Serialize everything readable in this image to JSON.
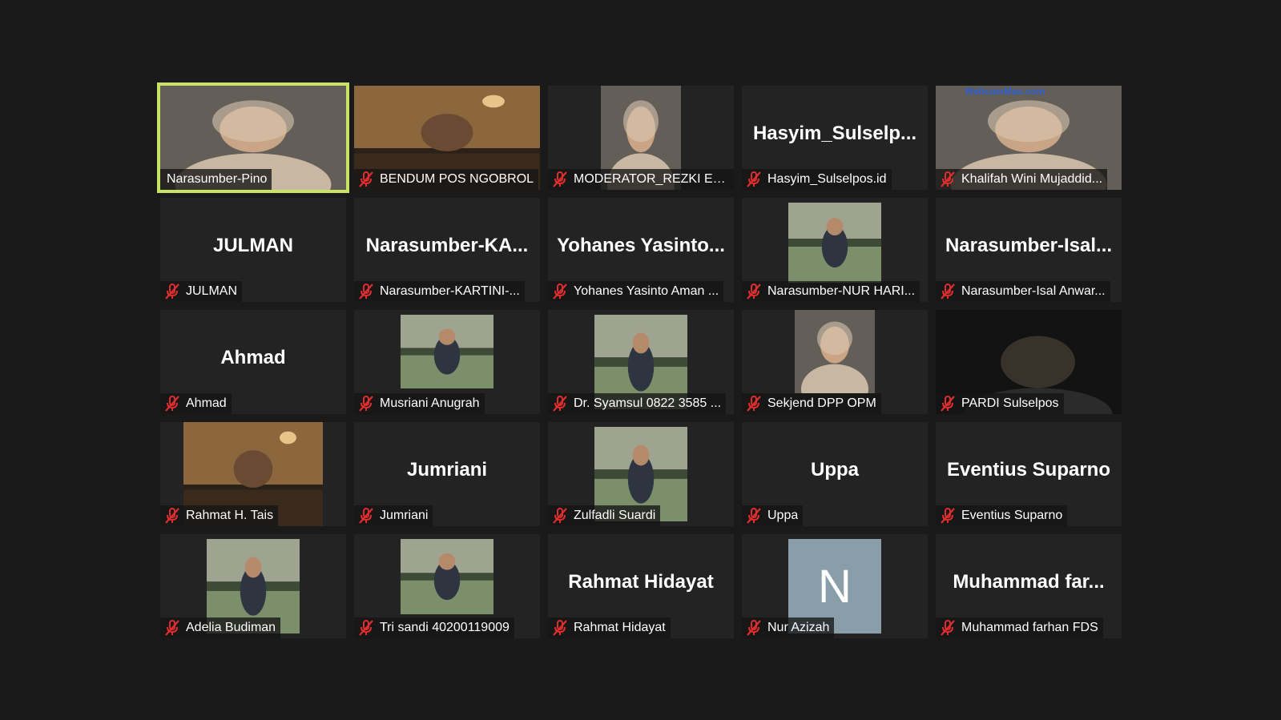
{
  "meeting": {
    "participants": [
      {
        "label": "Narasumber-Pino",
        "muted": false,
        "active": true,
        "video": "face"
      },
      {
        "label": "BENDUM POS NGOBROL",
        "muted": true,
        "video": "room"
      },
      {
        "label": "MODERATOR_REZKI EK...",
        "muted": true,
        "video": "face"
      },
      {
        "label": "Hasyim_Sulselpos.id",
        "muted": true,
        "big_name": "Hasyim_Sulselp..."
      },
      {
        "label": "Khalifah Wini Mujaddid...",
        "muted": true,
        "video": "face",
        "watermark": "WebcamMax.com"
      },
      {
        "label": "JULMAN",
        "muted": true,
        "big_name": "JULMAN"
      },
      {
        "label": "Narasumber-KARTINI-...",
        "muted": true,
        "big_name": "Narasumber-KA..."
      },
      {
        "label": "Yohanes Yasinto Aman ...",
        "muted": true,
        "big_name": "Yohanes  Yasinto..."
      },
      {
        "label": "Narasumber-NUR HARI...",
        "muted": true,
        "video": "photo"
      },
      {
        "label": "Narasumber-Isal Anwar...",
        "muted": true,
        "big_name": "Narasumber-Isal..."
      },
      {
        "label": "Ahmad",
        "muted": true,
        "big_name": "Ahmad"
      },
      {
        "label": "Musriani Anugrah",
        "muted": true,
        "video": "photo"
      },
      {
        "label": "Dr. Syamsul 0822 3585 ...",
        "muted": true,
        "video": "photo"
      },
      {
        "label": "Sekjend DPP OPM",
        "muted": true,
        "video": "face"
      },
      {
        "label": "PARDI Sulselpos",
        "muted": true,
        "video": "dark"
      },
      {
        "label": "Rahmat H. Tais",
        "muted": true,
        "video": "room"
      },
      {
        "label": "Jumriani",
        "muted": true,
        "big_name": "Jumriani"
      },
      {
        "label": "Zulfadli Suardi",
        "muted": true,
        "video": "photo"
      },
      {
        "label": "Uppa",
        "muted": true,
        "big_name": "Uppa"
      },
      {
        "label": "Eventius Suparno",
        "muted": true,
        "big_name": "Eventius Suparno"
      },
      {
        "label": "Adelia Budiman",
        "muted": true,
        "video": "photo"
      },
      {
        "label": "Tri sandi 40200119009",
        "muted": true,
        "video": "photo"
      },
      {
        "label": "Rahmat Hidayat",
        "muted": true,
        "big_name": "Rahmat Hidayat"
      },
      {
        "label": "Nur Azizah",
        "muted": true,
        "avatar_letter": "N",
        "avatar_color": "#8a9eaa"
      },
      {
        "label": "Muhammad farhan FDS",
        "muted": true,
        "big_name": "Muhammad  far..."
      }
    ]
  },
  "colors": {
    "background": "#1a1a1a",
    "tile": "#232323",
    "active_border": "#c9e265",
    "mute_red": "#e02d2d"
  }
}
